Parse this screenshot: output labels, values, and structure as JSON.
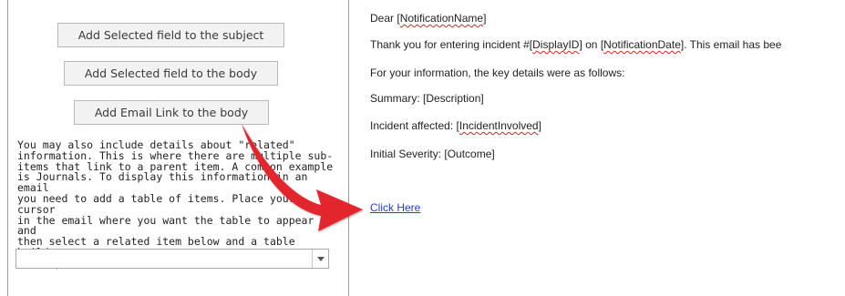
{
  "left_panel": {
    "buttons": {
      "subject": "Add Selected field to the subject",
      "body": "Add Selected field to the body",
      "email_link": "Add Email Link to the body"
    },
    "help_text": "You may also include details about \"related\"\ninformation. This is where there are multiple sub-\nitems that link to a parent item. A common example\nis Journals. To display this information in an email\nyou need to add a table of items. Place your cursor\nin the email where you want the table to appear and\nthen select a related item below and a table builder\nwill open for this item.",
    "related_select": {
      "value": ""
    }
  },
  "email_body": {
    "greeting": {
      "prefix": "Dear [",
      "field": "NotificationName",
      "suffix": "]"
    },
    "thanks": {
      "p1": "Thank you for entering incident #[",
      "f1": "DisplayID",
      "p2": "] on [",
      "f2": "NotificationDate",
      "p3": "]. This email has bee"
    },
    "key_details": "For your information, the key details were as follows:",
    "summary": "Summary: [Description]",
    "incident": {
      "prefix": "Incident affected: [",
      "field": "IncidentInvolved",
      "suffix": "]"
    },
    "severity": "Initial Severity: [Outcome]",
    "link": "Click Here"
  },
  "colors": {
    "annotation_arrow": "#e3262e",
    "link": "#1f3fd3",
    "spellcheck_squiggle": "#d8261e"
  },
  "icons": {
    "dropdown": "chevron-down-icon",
    "annotation": "red-arrow-icon"
  }
}
